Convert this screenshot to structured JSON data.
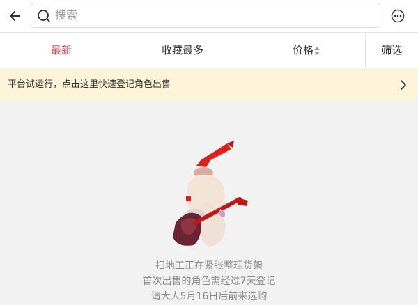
{
  "header": {
    "back_icon": "arrow-left-icon",
    "search": {
      "placeholder": "搜索",
      "icon": "search-icon"
    },
    "more_icon": "more-horizontal-circle-icon"
  },
  "sort_tabs": {
    "latest": "最新",
    "most_favorited": "收藏最多",
    "price": "价格",
    "price_icon": "sort-up-down-icon",
    "filter": "筛选",
    "active_color": "#e04c4c"
  },
  "notice_bar": {
    "text": "平台试运行，点击这里快速登记角色出售",
    "arrow_icon": "chevron-right-icon",
    "background": "#fdf3d8"
  },
  "empty_state": {
    "illustration": "character-with-staff-illustration",
    "lines": [
      "扫地工正在紧张整理货架",
      "首次出售的角色需经过7天登记",
      "请大人5月16日后前来选购"
    ]
  }
}
